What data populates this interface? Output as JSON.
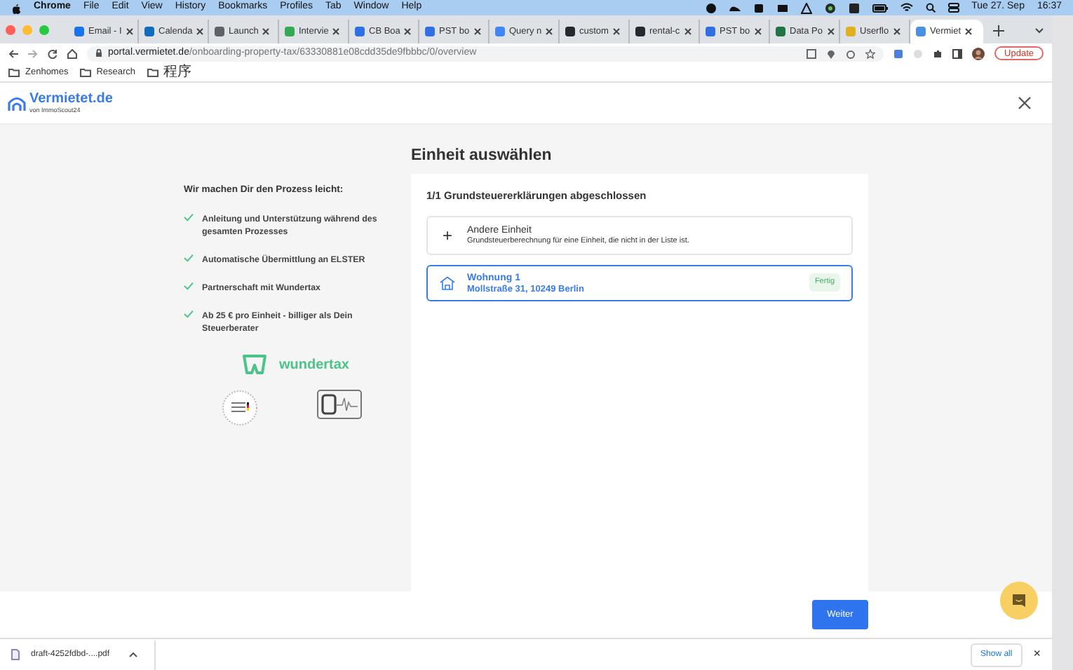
{
  "menu_bar": {
    "app": "Chrome",
    "items": [
      "File",
      "Edit",
      "View",
      "History",
      "Bookmarks",
      "Profiles",
      "Tab",
      "Window",
      "Help"
    ],
    "date": "Tue 27. Sep",
    "time": "16:37"
  },
  "tabs": [
    {
      "label": "Email - I",
      "color": "#1a73e8",
      "selected": false
    },
    {
      "label": "Calenda",
      "color": "#0f6cbd",
      "selected": false
    },
    {
      "label": "Launch",
      "color": "#5f6368",
      "selected": false
    },
    {
      "label": "Intervie",
      "color": "#34a853",
      "selected": false
    },
    {
      "label": "CB Boa",
      "color": "#2f6fe4",
      "selected": false
    },
    {
      "label": "PST bo",
      "color": "#2f6fe4",
      "selected": false
    },
    {
      "label": "Query n",
      "color": "#4285f4",
      "selected": false
    },
    {
      "label": "custom",
      "color": "#24292f",
      "selected": false
    },
    {
      "label": "rental-c",
      "color": "#24292f",
      "selected": false
    },
    {
      "label": "PST bo",
      "color": "#2f6fe4",
      "selected": false
    },
    {
      "label": "Data Po",
      "color": "#217346",
      "selected": false
    },
    {
      "label": "Userflo",
      "color": "#e0b020",
      "selected": false
    },
    {
      "label": "Vermiet",
      "color": "#4a90e2",
      "selected": true
    }
  ],
  "address_bar": {
    "host": "portal.vermietet.de",
    "path": "/onboarding-property-tax/63330881e08cdd35de9fbbbc/0/overview"
  },
  "update_button": "Update",
  "bookmarks": [
    "Zenhomes",
    "Research",
    "程序"
  ],
  "page": {
    "logo": {
      "name": "Vermietet.de",
      "tagline": "von ImmoScout24"
    },
    "benefits": {
      "heading": "Wir machen Dir den Prozess leicht:",
      "items": [
        "Anleitung und Unterstützung während des gesamten Prozesses",
        "Automatische Übermittlung an ELSTER",
        "Partnerschaft mit Wundertax",
        "Ab 25 € pro Einheit - billiger als Dein Steuerberater"
      ]
    },
    "partner": "wundertax",
    "title": "Einheit auswählen",
    "summary": "1/1 Grundsteuererklärungen abgeschlossen",
    "options": [
      {
        "kind": "add",
        "icon": "+",
        "title": "Andere Einheit",
        "subtitle": "Grundsteuerberechnung für eine Einheit, die nicht in der Liste ist.",
        "selected": false
      },
      {
        "kind": "unit",
        "title": "Wohnung 1",
        "subtitle": "Mollstraße 31, 10249 Berlin",
        "badge": "Fertig",
        "selected": true
      }
    ],
    "next_button": "Weiter"
  },
  "downloads": {
    "file": "draft-4252fdbd-....pdf",
    "show_all": "Show all",
    "close": "×"
  }
}
